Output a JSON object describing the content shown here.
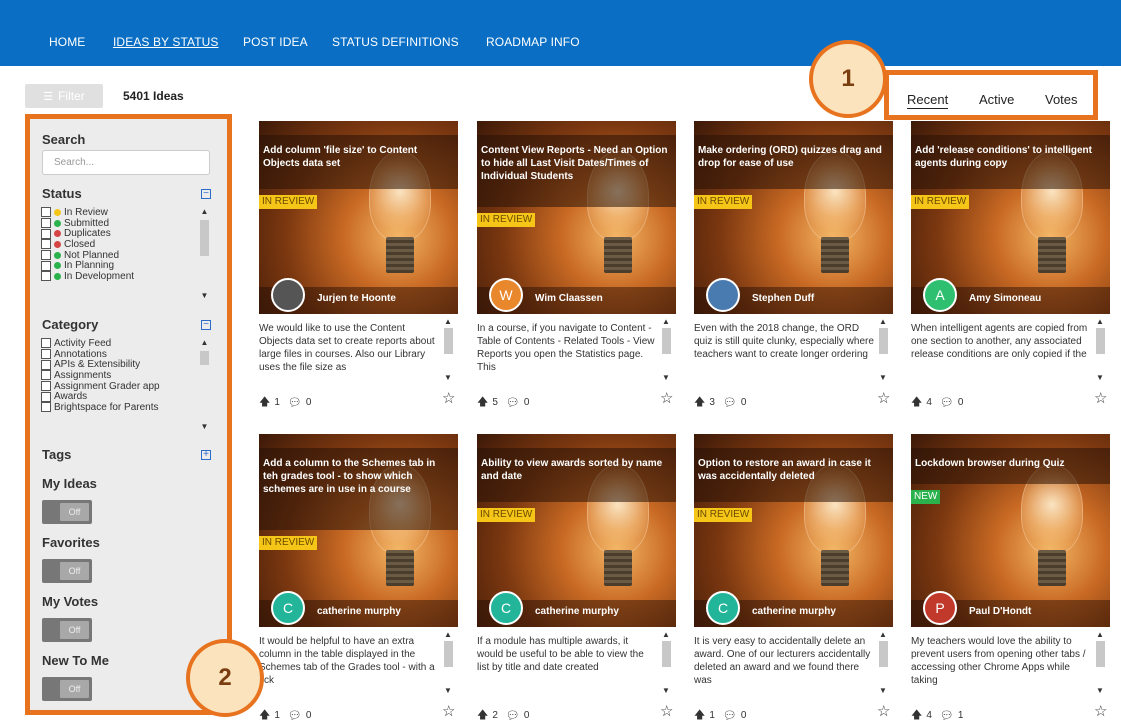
{
  "nav": [
    "HOME",
    "IDEAS BY STATUS",
    "POST IDEA",
    "STATUS DEFINITIONS",
    "ROADMAP INFO"
  ],
  "toolbar": {
    "filter_label": "Filter",
    "idea_count": "5401 Ideas"
  },
  "sort": [
    "Recent",
    "Active",
    "Votes"
  ],
  "callouts": [
    "1",
    "2"
  ],
  "sidebar": {
    "search_heading": "Search",
    "search_placeholder": "Search...",
    "status_heading": "Status",
    "statuses": [
      {
        "label": "In Review",
        "color": "#f5c518"
      },
      {
        "label": "Submitted",
        "color": "#2bb24c"
      },
      {
        "label": "Duplicates",
        "color": "#d64545"
      },
      {
        "label": "Closed",
        "color": "#d64545"
      },
      {
        "label": "Not Planned",
        "color": "#2bb24c"
      },
      {
        "label": "In Planning",
        "color": "#2bb24c"
      },
      {
        "label": "In Development",
        "color": "#2bb24c"
      }
    ],
    "category_heading": "Category",
    "categories": [
      "Activity Feed",
      "Annotations",
      "APIs & Extensibility",
      "Assignments",
      "Assignment Grader app",
      "Awards",
      "Brightspace for Parents"
    ],
    "tags_heading": "Tags",
    "toggles": [
      {
        "label": "My Ideas",
        "state": "Off"
      },
      {
        "label": "Favorites",
        "state": "Off"
      },
      {
        "label": "My Votes",
        "state": "Off"
      },
      {
        "label": "New To Me",
        "state": "Off"
      }
    ]
  },
  "cards": [
    {
      "title": "Add column 'file size' to Content Objects data set",
      "status": "IN REVIEW",
      "status_type": "review",
      "author": "Jurjen te Hoonte",
      "avatar": "",
      "avatar_color": "#555555",
      "desc": "We would like to use the Content Objects data set to create reports about large files in courses. Also our Library uses the file size as",
      "votes": "1",
      "comments": "0"
    },
    {
      "title": "Content View Reports - Need an Option to hide all Last Visit Dates/Times of Individual Students",
      "status": "IN REVIEW",
      "status_type": "review",
      "author": "Wim Claassen",
      "avatar": "W",
      "avatar_color": "#e8872c",
      "desc": "In a course, if you navigate to Content - Table of Contents - Related Tools - View Reports you open the Statistics page. This",
      "votes": "5",
      "comments": "0"
    },
    {
      "title": "Make ordering (ORD) quizzes drag and drop for ease of use",
      "status": "IN REVIEW",
      "status_type": "review",
      "author": "Stephen Duff",
      "avatar": "",
      "avatar_color": "#4a7bb0",
      "desc": "Even with the 2018 change, the ORD quiz is still quite clunky, especially where teachers want to create longer ordering",
      "votes": "3",
      "comments": "0"
    },
    {
      "title": "Add 'release conditions' to intelligent agents during copy",
      "status": "IN REVIEW",
      "status_type": "review",
      "author": "Amy Simoneau",
      "avatar": "A",
      "avatar_color": "#2fbf71",
      "desc": "When intelligent agents are copied from one section to another, any associated release conditions are only copied if the",
      "votes": "4",
      "comments": "0"
    },
    {
      "title": "Add a column to the Schemes tab in teh grades tool - to show which schemes are in use in a course",
      "status": "IN REVIEW",
      "status_type": "review",
      "author": "catherine murphy",
      "avatar": "C",
      "avatar_color": "#22b59a",
      "desc": "It would be helpful to have an extra column in the table displayed in the Schemes tab of the Grades tool - with a tick",
      "votes": "1",
      "comments": "0"
    },
    {
      "title": "Ability to view awards sorted by name and date",
      "status": "IN REVIEW",
      "status_type": "review",
      "author": "catherine murphy",
      "avatar": "C",
      "avatar_color": "#22b59a",
      "desc": "If a module has multiple awards, it would be useful to be able to view the list by title and date created",
      "votes": "2",
      "comments": "0"
    },
    {
      "title": "Option to restore an award in case it was accidentally deleted",
      "status": "IN REVIEW",
      "status_type": "review",
      "author": "catherine murphy",
      "avatar": "C",
      "avatar_color": "#22b59a",
      "desc": "It is very easy to accidentally delete an award. One of our lecturers accidentally deleted an award and we found there was",
      "votes": "1",
      "comments": "0"
    },
    {
      "title": "Lockdown browser during Quiz",
      "status": "NEW",
      "status_type": "new",
      "author": "Paul D'Hondt",
      "avatar": "P",
      "avatar_color": "#c0392b",
      "desc": "My teachers would love the ability to prevent users from opening other tabs / accessing other Chrome Apps while taking",
      "votes": "4",
      "comments": "1"
    }
  ]
}
